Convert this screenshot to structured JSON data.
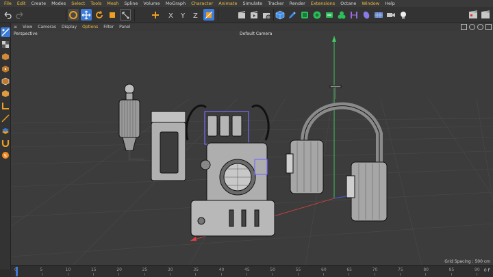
{
  "menu": {
    "items": [
      {
        "label": "File",
        "highlight": true
      },
      {
        "label": "Edit",
        "highlight": true
      },
      {
        "label": "Create",
        "highlight": false
      },
      {
        "label": "Modes",
        "highlight": false
      },
      {
        "label": "Select",
        "highlight": true
      },
      {
        "label": "Tools",
        "highlight": true
      },
      {
        "label": "Mesh",
        "highlight": true
      },
      {
        "label": "Spline",
        "highlight": false
      },
      {
        "label": "Volume",
        "highlight": false
      },
      {
        "label": "MoGraph",
        "highlight": false
      },
      {
        "label": "Character",
        "highlight": true
      },
      {
        "label": "Animate",
        "highlight": true
      },
      {
        "label": "Simulate",
        "highlight": false
      },
      {
        "label": "Tracker",
        "highlight": false
      },
      {
        "label": "Render",
        "highlight": false
      },
      {
        "label": "Extensions",
        "highlight": true
      },
      {
        "label": "Octane",
        "highlight": false
      },
      {
        "label": "Window",
        "highlight": true
      },
      {
        "label": "Help",
        "highlight": false
      }
    ]
  },
  "viewport_menu": {
    "items": [
      {
        "label": "View",
        "highlight": false
      },
      {
        "label": "Cameras",
        "highlight": false
      },
      {
        "label": "Display",
        "highlight": false
      },
      {
        "label": "Options",
        "highlight": true
      },
      {
        "label": "Filter",
        "highlight": false
      },
      {
        "label": "Panel",
        "highlight": false
      }
    ]
  },
  "viewport": {
    "projection_label": "Perspective",
    "camera_label": "Default Camera",
    "grid_spacing": "Grid Spacing : 500 cm"
  },
  "timeline": {
    "ticks": [
      "0",
      "5",
      "10",
      "15",
      "20",
      "25",
      "30",
      "35",
      "40",
      "45",
      "50",
      "55",
      "60",
      "65",
      "70",
      "75",
      "80",
      "85",
      "90"
    ],
    "current_frame": "0 F"
  },
  "colors": {
    "accent": "#f0c040",
    "active_tool": "#3d7bd8",
    "axis_x": "#e04040",
    "axis_y": "#40d060",
    "axis_z": "#4060e0",
    "selection": "#7a6cff"
  }
}
